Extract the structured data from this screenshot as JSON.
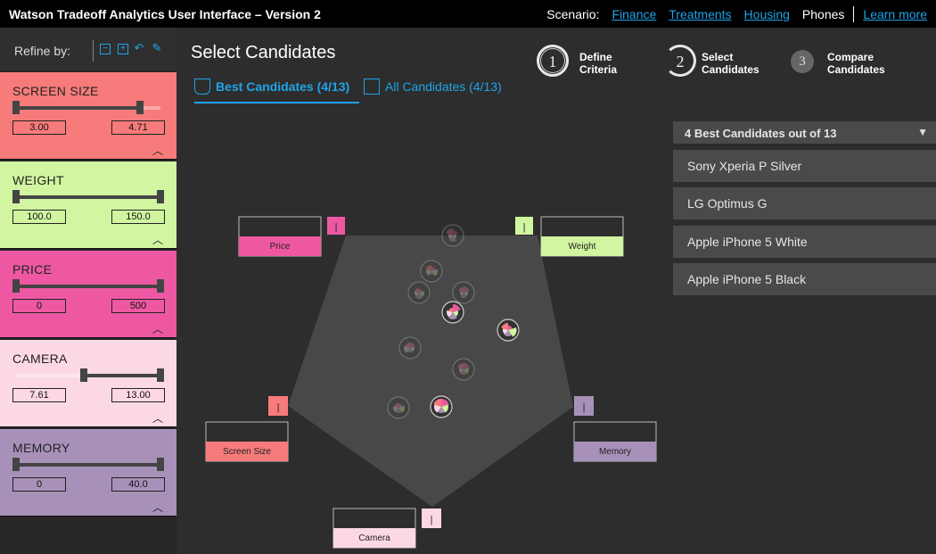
{
  "header": {
    "title": "Watson Tradeoff Analytics User Interface – Version 2",
    "scenario_label": "Scenario:",
    "links": [
      "Finance",
      "Treatments",
      "Housing"
    ],
    "current": "Phones",
    "learn_more": "Learn more"
  },
  "sidebar": {
    "refine_label": "Refine by:",
    "tools": [
      "collapse-all-icon",
      "expand-all-icon",
      "reset-icon",
      "edit-icon"
    ],
    "filters": [
      {
        "name": "SCREEN SIZE",
        "min": "3.00",
        "max": "4.71",
        "color": "#f77b7b",
        "low_fraction": 0.0,
        "high_fraction": 0.86
      },
      {
        "name": "WEIGHT",
        "min": "100.0",
        "max": "150.0",
        "color": "#d1f5a0",
        "low_fraction": 0.0,
        "high_fraction": 1.0
      },
      {
        "name": "PRICE",
        "min": "0",
        "max": "500",
        "color": "#ee58a2",
        "low_fraction": 0.0,
        "high_fraction": 1.0
      },
      {
        "name": "CAMERA",
        "min": "7.61",
        "max": "13.00",
        "color": "#fcd8e4",
        "low_fraction": 0.47,
        "high_fraction": 1.0
      },
      {
        "name": "MEMORY",
        "min": "0",
        "max": "40.0",
        "color": "#a791b9",
        "low_fraction": 0.0,
        "high_fraction": 1.0
      }
    ]
  },
  "main": {
    "title": "Select Candidates",
    "steps": [
      {
        "num": "1",
        "label": [
          "Define",
          "Criteria"
        ]
      },
      {
        "num": "2",
        "label": [
          "Select",
          "Candidates"
        ]
      },
      {
        "num": "3",
        "label": [
          "Compare",
          "Candidates"
        ]
      }
    ],
    "tabs": [
      "Best Candidates (4/13)",
      "All Candidates (4/13)"
    ]
  },
  "viz": {
    "axes": [
      {
        "label": "Price",
        "marker": "|",
        "color": "#ee58a2"
      },
      {
        "label": "Weight",
        "marker": "|",
        "color": "#d1f5a0"
      },
      {
        "label": "Memory",
        "marker": "|",
        "color": "#a791b9"
      },
      {
        "label": "Camera",
        "marker": "|",
        "color": "#fcd8e4"
      },
      {
        "label": "Screen Size",
        "marker": "|",
        "color": "#f77b7b"
      }
    ]
  },
  "candidates": {
    "header": "4 Best Candidates out of 13",
    "items": [
      "Sony Xperia P Silver",
      "LG Optimus G",
      "Apple iPhone 5 White",
      "Apple iPhone 5 Black"
    ]
  },
  "colors": {
    "accent": "#1fa3e8"
  }
}
